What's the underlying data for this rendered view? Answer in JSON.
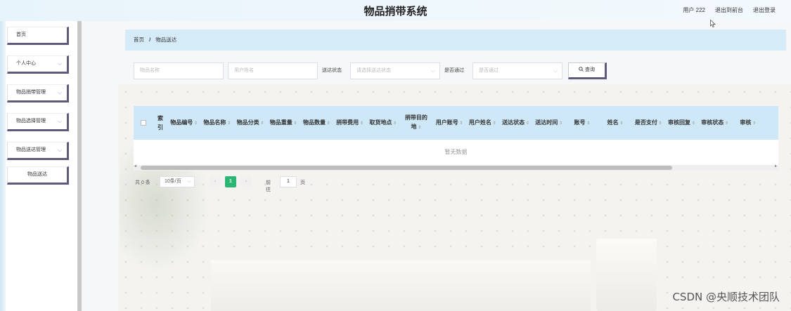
{
  "header": {
    "title": "物品捎带系统",
    "user_label": "用户 222",
    "exit_to_front": "退出到前台",
    "logout": "退出登录"
  },
  "sidebar": {
    "items": [
      {
        "label": "首页",
        "has_chevron": false
      },
      {
        "label": "个人中心",
        "has_chevron": true
      },
      {
        "label": "物品捎带管理",
        "has_chevron": true
      },
      {
        "label": "物品选择管理",
        "has_chevron": true
      },
      {
        "label": "物品送达管理",
        "has_chevron": true
      }
    ],
    "sub_item": "物品送达"
  },
  "breadcrumb": {
    "home": "首页",
    "separator": "/",
    "current": "物品送达"
  },
  "filters": {
    "item_name_placeholder": "物品名称",
    "user_name_placeholder": "用户姓名",
    "delivery_status_label": "送达状态",
    "delivery_status_placeholder": "请选择送达状态",
    "approved_label": "是否通过",
    "approved_placeholder": "是否通过",
    "query_button": "查询",
    "search_icon": "search-icon"
  },
  "table": {
    "index_header": "索引",
    "columns": [
      "物品编号",
      "物品名称",
      "物品分类",
      "物品重量",
      "物品数量",
      "捎带费用",
      "取货地点",
      "捎带目的地",
      "用户账号",
      "用户姓名",
      "送达状态",
      "送达时间",
      "账号",
      "姓名",
      "是否支付",
      "审核回复",
      "审核状态",
      "审核"
    ],
    "empty_text": "暂无数据"
  },
  "pagination": {
    "total": "共 0 条",
    "page_size": "10条/页",
    "current_page": "1",
    "goto_label": "前往",
    "goto_value": "1",
    "page_suffix": "页"
  },
  "watermark": "CSDN @央顺技术团队",
  "colors": {
    "accent_green": "#2bb673",
    "header_blue": "#cfe8f7",
    "border_purple": "#5e5a7e"
  }
}
